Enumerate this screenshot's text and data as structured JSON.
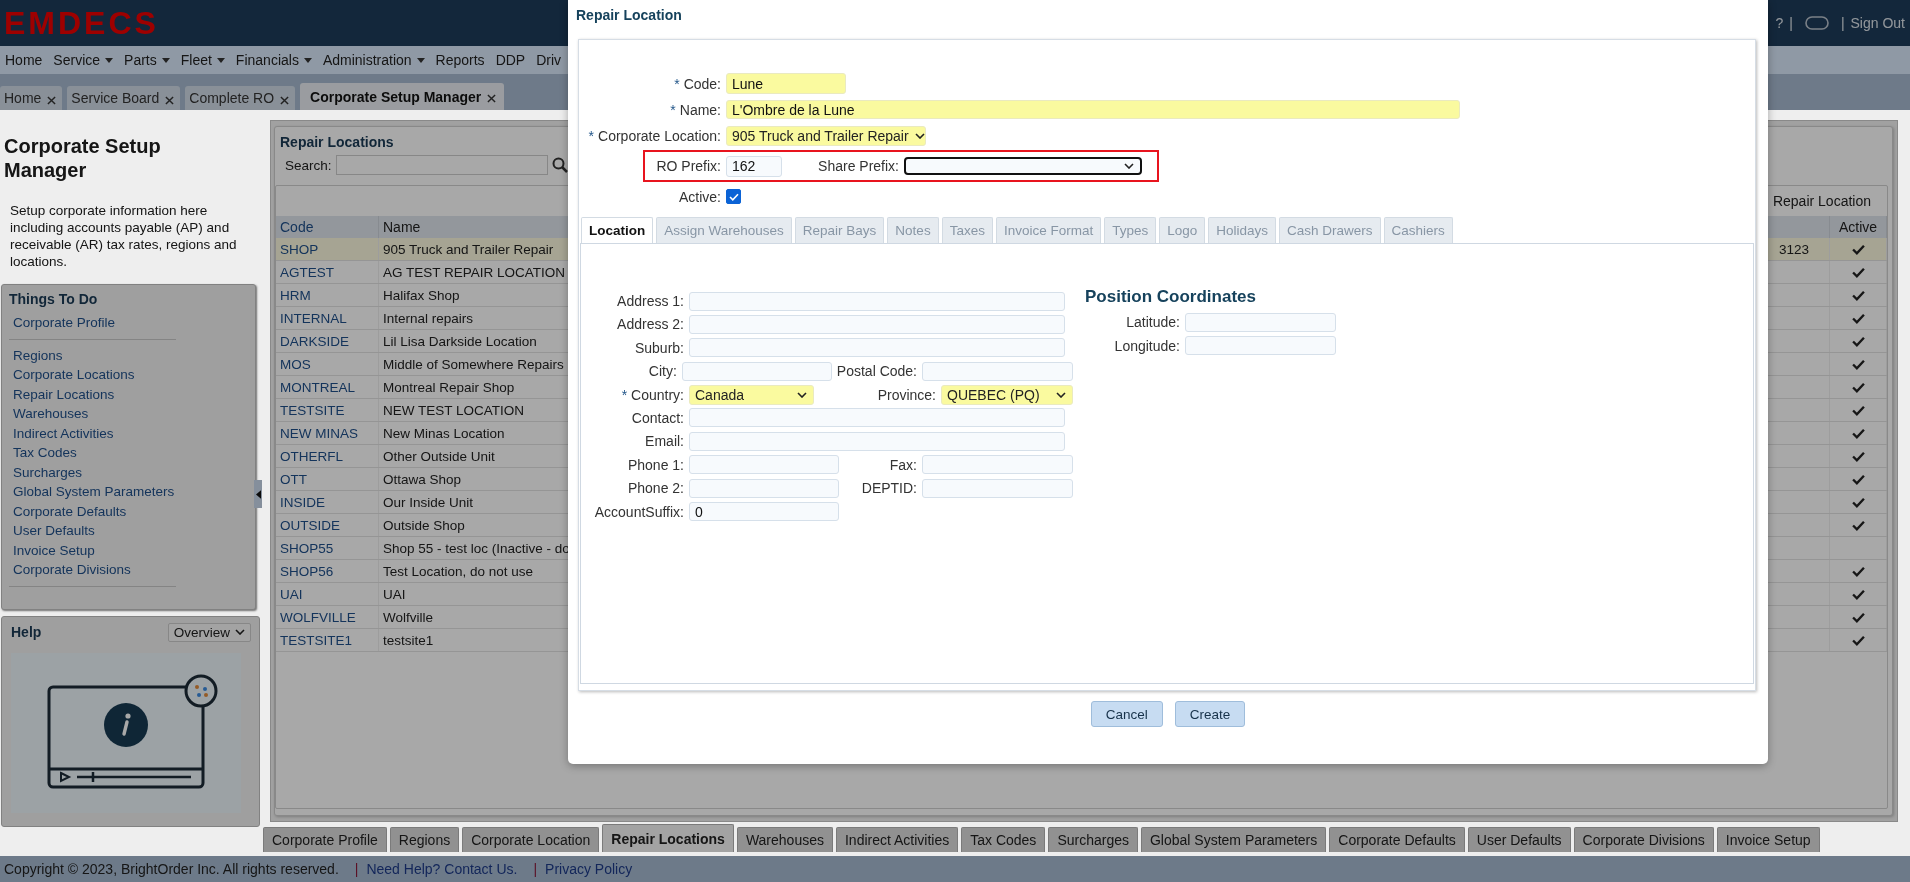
{
  "header": {
    "logo": "EMDECS",
    "items": [
      {
        "kind": "text",
        "label": "?"
      },
      {
        "kind": "separator",
        "label": "|"
      },
      {
        "kind": "chat_icon"
      },
      {
        "kind": "separator",
        "label": "|"
      },
      {
        "kind": "link",
        "label": "Sign Out"
      }
    ]
  },
  "menu": [
    {
      "label": "Home",
      "dropdown": false
    },
    {
      "label": "Service",
      "dropdown": true
    },
    {
      "label": "Parts",
      "dropdown": true
    },
    {
      "label": "Fleet",
      "dropdown": true
    },
    {
      "label": "Financials",
      "dropdown": true
    },
    {
      "label": "Administration",
      "dropdown": true
    },
    {
      "label": "Reports",
      "dropdown": false
    },
    {
      "label": "DDP",
      "dropdown": false
    },
    {
      "label": "Driv",
      "dropdown": false
    }
  ],
  "page_tabs": [
    {
      "label": "Home",
      "selected": false
    },
    {
      "label": "Service Board",
      "selected": false
    },
    {
      "label": "Complete RO",
      "selected": false
    },
    {
      "label": "Corporate Setup Manager",
      "selected": true
    }
  ],
  "sidebar": {
    "title": "Corporate Setup Manager",
    "description": "Setup corporate information here including accounts payable (AP) and receivable (AR) tax rates, regions and locations.",
    "things_to_do": {
      "title": "Things To Do",
      "groups": [
        [
          "Corporate Profile"
        ],
        [
          "Regions",
          "Corporate Locations",
          "Repair Locations",
          "Warehouses",
          "Indirect Activities",
          "Tax Codes",
          "Surcharges",
          "Global System Parameters",
          "Corporate Defaults",
          "User Defaults",
          "Invoice Setup",
          "Corporate Divisions"
        ]
      ]
    },
    "help": {
      "title": "Help",
      "dropdown": "Overview"
    }
  },
  "repair_locations": {
    "title": "Repair Locations",
    "search": {
      "label": "Search:"
    },
    "toolbar_link": "Repair Location",
    "table": {
      "columns": {
        "code": "Code",
        "name": "Name",
        "active": "Active"
      },
      "rows": [
        {
          "code": "SHOP",
          "name": "905 Truck and Trailer Repair",
          "column_3": "3123",
          "active": true,
          "selected": true
        },
        {
          "code": "AGTEST",
          "name": "AG TEST REPAIR LOCATION",
          "active": true,
          "selected": false
        },
        {
          "code": "HRM",
          "name": "Halifax Shop",
          "active": true,
          "selected": false
        },
        {
          "code": "INTERNAL",
          "name": "Internal repairs",
          "active": true,
          "selected": false
        },
        {
          "code": "DARKSIDE",
          "name": "Lil Lisa Darkside Location",
          "active": true,
          "selected": false
        },
        {
          "code": "MOS",
          "name": "Middle of Somewhere Repairs",
          "active": true,
          "selected": false
        },
        {
          "code": "MONTREAL",
          "name": "Montreal Repair Shop",
          "active": true,
          "selected": false
        },
        {
          "code": "TESTSITE",
          "name": "NEW TEST LOCATION",
          "active": true,
          "selected": false
        },
        {
          "code": "NEW MINAS",
          "name": "New Minas Location",
          "active": true,
          "selected": false
        },
        {
          "code": "OTHERFL",
          "name": "Other Outside Unit",
          "active": true,
          "selected": false
        },
        {
          "code": "OTT",
          "name": "Ottawa Shop",
          "active": true,
          "selected": false
        },
        {
          "code": "INSIDE",
          "name": "Our Inside Unit",
          "active": true,
          "selected": false
        },
        {
          "code": "OUTSIDE",
          "name": "Outside Shop",
          "active": true,
          "selected": false
        },
        {
          "code": "SHOP55",
          "name": "Shop 55 - test loc (Inactive - do",
          "active": false,
          "selected": false
        },
        {
          "code": "SHOP56",
          "name": "Test Location, do not use",
          "active": true,
          "selected": false
        },
        {
          "code": "UAI",
          "name": "UAI",
          "active": true,
          "selected": false
        },
        {
          "code": "WOLFVILLE",
          "name": "Wolfville",
          "active": true,
          "selected": false
        },
        {
          "code": "TESTSITE1",
          "name": "testsite1",
          "active": true,
          "selected": false
        }
      ]
    }
  },
  "bottom_tabs": [
    {
      "label": "Corporate Profile",
      "selected": false
    },
    {
      "label": "Regions",
      "selected": false
    },
    {
      "label": "Corporate Location",
      "selected": false
    },
    {
      "label": "Repair Locations",
      "selected": true
    },
    {
      "label": "Warehouses",
      "selected": false
    },
    {
      "label": "Indirect Activities",
      "selected": false
    },
    {
      "label": "Tax Codes",
      "selected": false
    },
    {
      "label": "Surcharges",
      "selected": false
    },
    {
      "label": "Global System Parameters",
      "selected": false
    },
    {
      "label": "Corporate Defaults",
      "selected": false
    },
    {
      "label": "User Defaults",
      "selected": false
    },
    {
      "label": "Corporate Divisions",
      "selected": false
    },
    {
      "label": "Invoice Setup",
      "selected": false
    }
  ],
  "footer": {
    "items": [
      {
        "kind": "text",
        "label": "Copyright © 2023, BrightOrder Inc. All rights reserved."
      },
      {
        "kind": "separator",
        "label": "|"
      },
      {
        "kind": "link",
        "label": "Need Help? Contact Us."
      },
      {
        "kind": "separator",
        "label": "|"
      },
      {
        "kind": "link",
        "label": "Privacy Policy"
      }
    ]
  },
  "dialog": {
    "title": "Repair Location",
    "code": {
      "marker": "*",
      "label": "Code:",
      "value": "Lune",
      "highlighted": true
    },
    "name": {
      "marker": "*",
      "label": "Name:",
      "value": "L'Ombre de la Lune",
      "highlighted": true
    },
    "corporate_location": {
      "marker": "*",
      "label": "Corporate Location:",
      "value": "905 Truck and Trailer Repair",
      "highlighted": true
    },
    "ro_prefix": {
      "label": "RO Prefix:",
      "value": "162",
      "highlighted": false
    },
    "share_prefix": {
      "label": "Share Prefix:",
      "focused": true
    },
    "active": {
      "label": "Active:",
      "checked": true
    },
    "tabs": [
      {
        "label": "Location",
        "selected": true
      },
      {
        "label": "Assign Warehouses",
        "selected": false
      },
      {
        "label": "Repair Bays",
        "selected": false
      },
      {
        "label": "Notes",
        "selected": false
      },
      {
        "label": "Taxes",
        "selected": false
      },
      {
        "label": "Invoice Format",
        "selected": false
      },
      {
        "label": "Types",
        "selected": false
      },
      {
        "label": "Logo",
        "selected": false
      },
      {
        "label": "Holidays",
        "selected": false
      },
      {
        "label": "Cash Drawers",
        "selected": false
      },
      {
        "label": "Cashiers",
        "selected": false
      }
    ],
    "location": {
      "rows": [
        {
          "kind": "single",
          "label": "Address 1:"
        },
        {
          "kind": "single",
          "label": "Address 2:"
        },
        {
          "kind": "single",
          "label": "Suburb:"
        },
        {
          "kind": "pair",
          "items": [
            {
              "kind": "input",
              "label": "City:"
            },
            {
              "kind": "input",
              "label": "Postal Code:"
            }
          ]
        },
        {
          "kind": "pair",
          "items": [
            {
              "kind": "select",
              "marker": "*",
              "label": "Country:",
              "value": "Canada",
              "highlighted": true
            },
            {
              "kind": "select",
              "label": "Province:",
              "value": "QUEBEC (PQ)",
              "highlighted": true
            }
          ]
        },
        {
          "kind": "single",
          "label": "Contact:"
        },
        {
          "kind": "single",
          "label": "Email:"
        },
        {
          "kind": "pair",
          "items": [
            {
              "kind": "input",
              "label": "Phone 1:"
            },
            {
              "kind": "input",
              "label": "Fax:"
            }
          ]
        },
        {
          "kind": "pair",
          "items": [
            {
              "kind": "input",
              "label": "Phone 2:"
            },
            {
              "kind": "input",
              "label": "DEPTID:"
            }
          ]
        },
        {
          "kind": "short",
          "label": "AccountSuffix:",
          "value": "0"
        }
      ],
      "coordinates": {
        "title": "Position Coordinates",
        "fields": [
          {
            "label": "Latitude:"
          },
          {
            "label": "Longitude:"
          }
        ]
      }
    },
    "buttons": [
      {
        "label": "Cancel"
      },
      {
        "label": "Create"
      }
    ]
  }
}
